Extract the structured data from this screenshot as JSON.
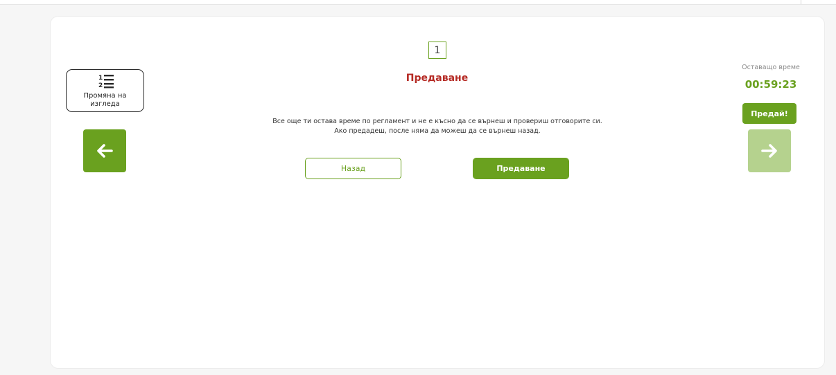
{
  "colors": {
    "accent": "#6aa11f",
    "accent_disabled": "#b5d28e",
    "title_red": "#b52a24"
  },
  "view_toggle": {
    "label": "Промяна на изгледа",
    "icon": "numbered-list-icon"
  },
  "navigation": {
    "prev_icon": "arrow-left-icon",
    "next_icon": "arrow-right-icon"
  },
  "question": {
    "number": "1"
  },
  "submit_panel": {
    "title": "Предаване",
    "message_line1": "Все още ти остава време по регламент и не е късно да се върнеш и провериш отговорите си.",
    "message_line2": "Ако предадеш, после няма да можеш да се върнеш назад.",
    "back_label": "Назад",
    "submit_label": "Предаване"
  },
  "timer": {
    "label": "Оставащо време",
    "value": "00:59:23"
  },
  "quick_submit": {
    "label": "Предай!"
  }
}
